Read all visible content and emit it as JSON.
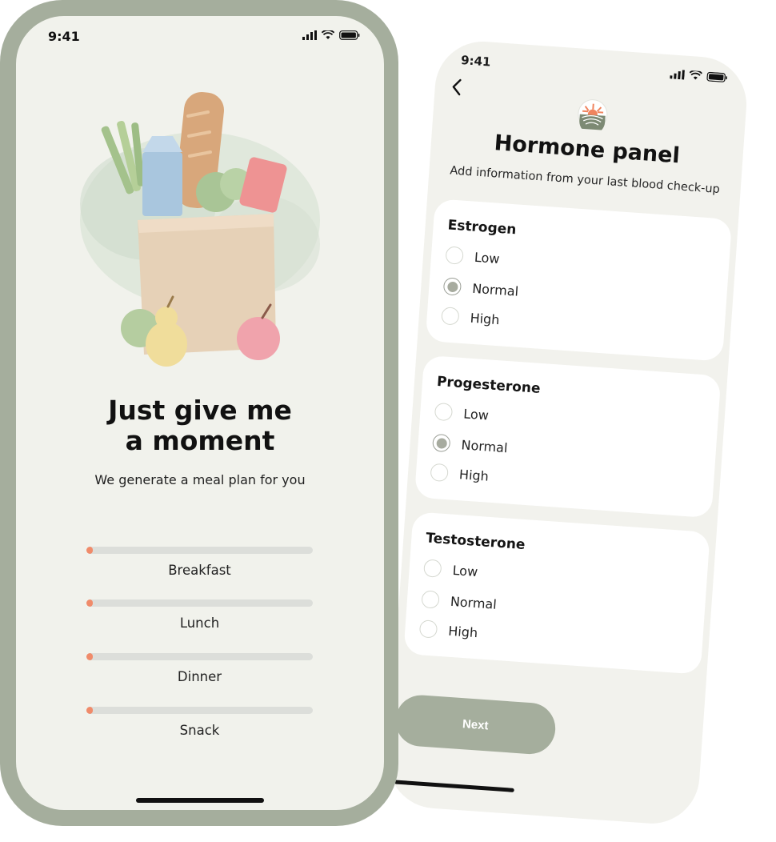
{
  "phone_right": {
    "status": {
      "time": "9:41"
    },
    "back_icon": "chevron-left-icon",
    "title": "Hormone panel",
    "subtitle": "Add information from your last blood check-up",
    "sections": [
      {
        "title": "Estrogen",
        "options": [
          "Low",
          "Normal",
          "High"
        ],
        "selected": "Normal"
      },
      {
        "title": "Progesterone",
        "options": [
          "Low",
          "Normal",
          "High"
        ],
        "selected": "Normal"
      },
      {
        "title": "Testosterone",
        "options": [
          "Low",
          "Normal",
          "High"
        ],
        "selected": null
      }
    ],
    "next_label": "Next"
  },
  "phone_left": {
    "status": {
      "time": "9:41"
    },
    "title_line1": "Just give me",
    "title_line2": "a moment",
    "subtitle": "We generate a meal plan for you",
    "progress": [
      {
        "label": "Breakfast",
        "percent": 3
      },
      {
        "label": "Lunch",
        "percent": 3
      },
      {
        "label": "Dinner",
        "percent": 3
      },
      {
        "label": "Snack",
        "percent": 3
      }
    ]
  },
  "colors": {
    "frame": "#a5ae9d",
    "screen": "#f1f2ec",
    "accent": "#f08b6a",
    "track": "#dcdeda",
    "button": "#a5ae9d"
  }
}
